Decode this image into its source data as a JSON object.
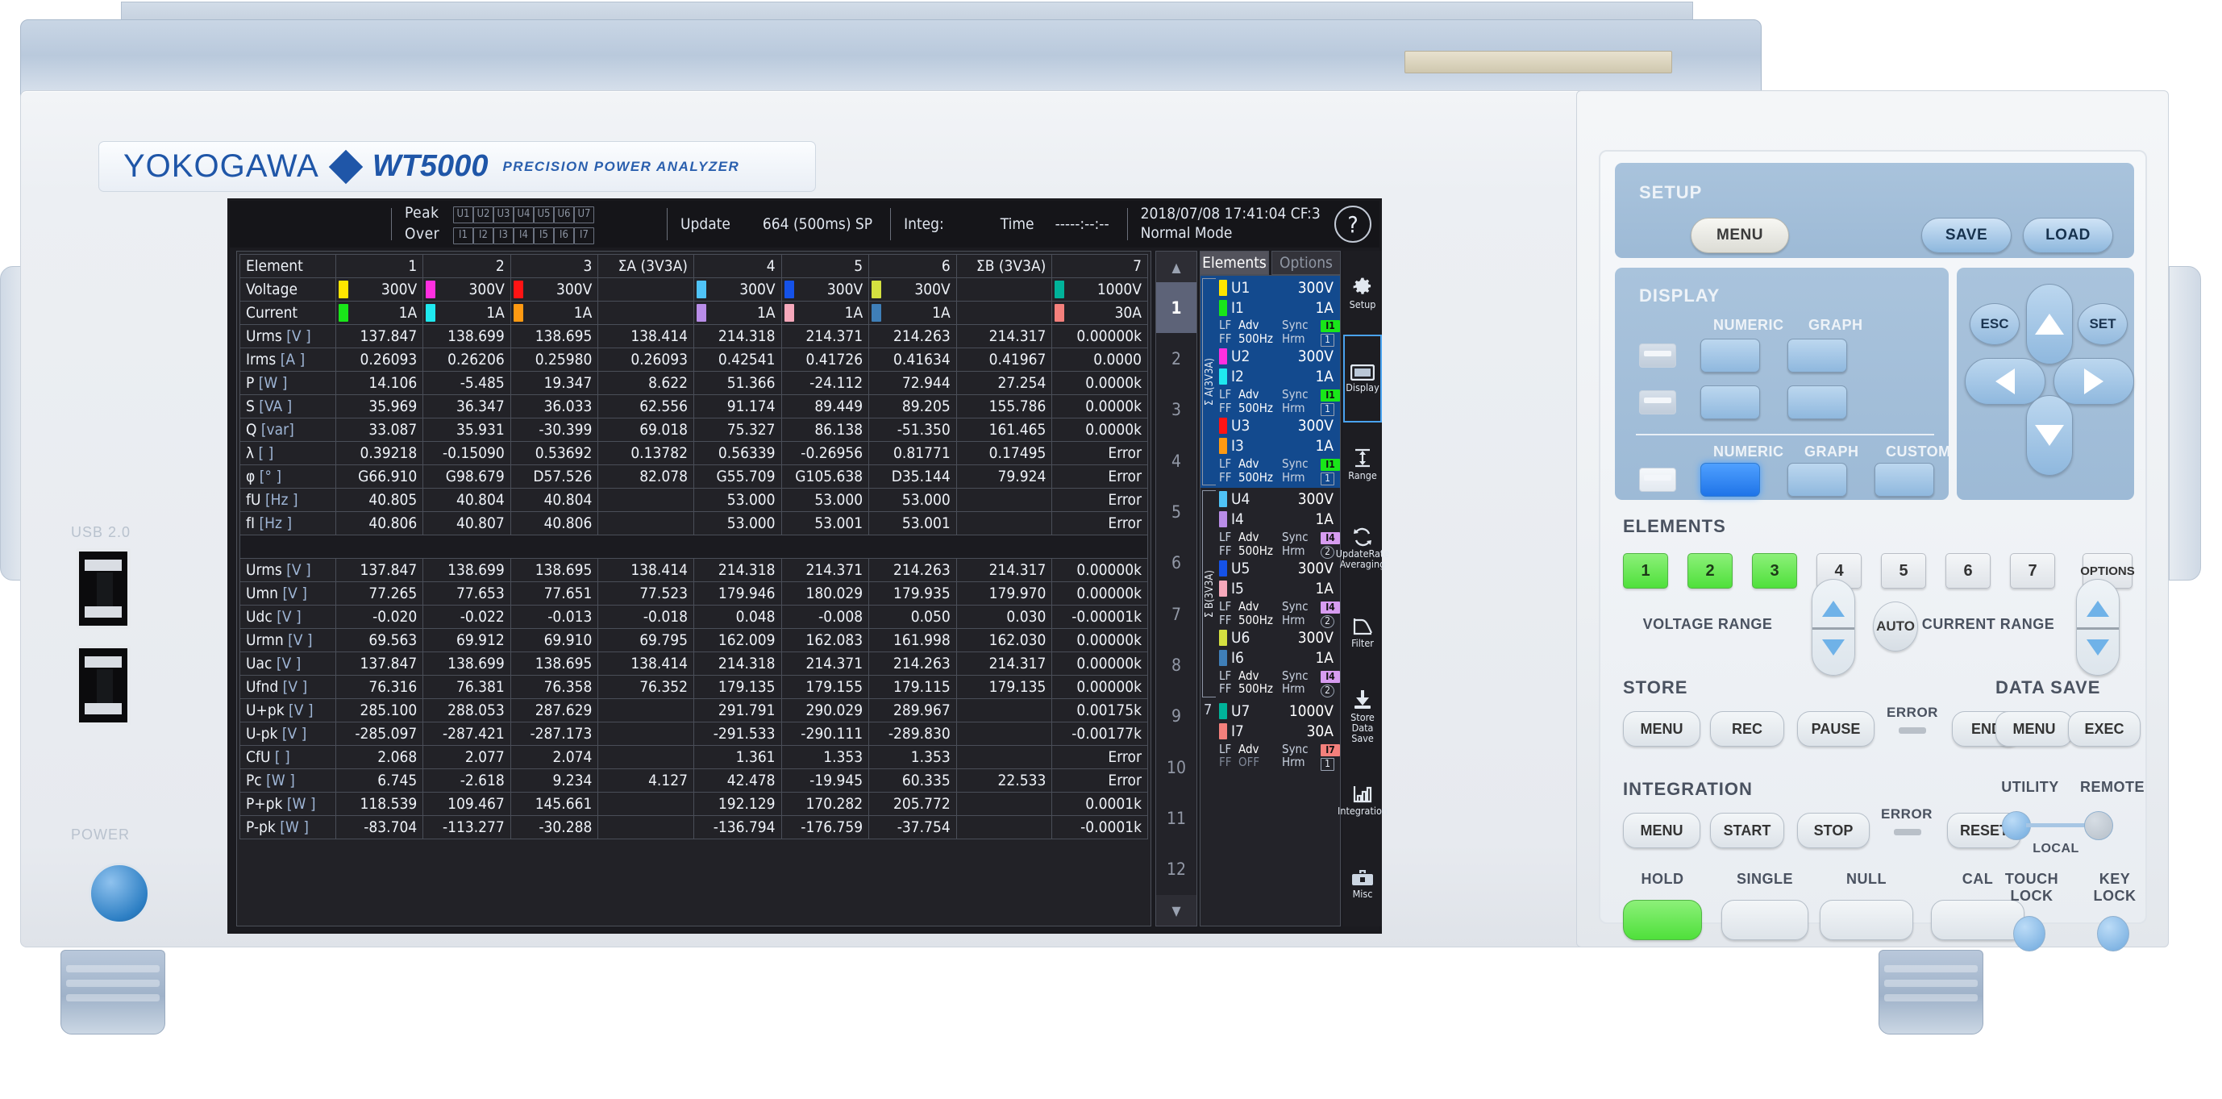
{
  "device": {
    "brand": "YOKOGAWA",
    "model": "WT5000",
    "subtitle": "PRECISION POWER ANALYZER",
    "io": {
      "usb_label": "USB 2.0",
      "power_label": "POWER"
    }
  },
  "screen": {
    "topbar": {
      "peak_label": "Peak",
      "over_label": "Over",
      "peak_chips": [
        "U1",
        "U2",
        "U3",
        "U4",
        "U5",
        "U6",
        "U7"
      ],
      "over_chips": [
        "I1",
        "I2",
        "I3",
        "I4",
        "I5",
        "I6",
        "I7"
      ],
      "update_label": "Update",
      "update_value": "664 (500ms) SP",
      "integ_label": "Integ:",
      "time_label": "Time",
      "time_value": "-----:--:--",
      "datetime": "2018/07/08 17:41:04 CF:3",
      "mode": "Normal Mode",
      "help_icon": "question-mark-icon"
    },
    "table": {
      "header_label": "Element",
      "columns": [
        "1",
        "2",
        "3",
        "ΣA (3V3A)",
        "4",
        "5",
        "6",
        "ΣB (3V3A)",
        "7"
      ],
      "voltage_label": "Voltage",
      "current_label": "Current",
      "voltage_ranges": [
        "300V",
        "300V",
        "300V",
        "",
        "300V",
        "300V",
        "300V",
        "",
        "1000V"
      ],
      "current_ranges": [
        "1A",
        "1A",
        "1A",
        "",
        "1A",
        "1A",
        "1A",
        "",
        "30A"
      ],
      "voltage_colors": [
        "#ffe500",
        "#ff2fe0",
        "#ff1414",
        "",
        "#4fc3f7",
        "#1552e8",
        "#d4e040",
        "",
        "#00b39a"
      ],
      "current_colors": [
        "#19e619",
        "#1fe9ef",
        "#ff9a12",
        "",
        "#b98de8",
        "#f6a8bb",
        "#3f7fb8",
        "",
        "#f4807c"
      ],
      "section1": [
        {
          "name": "Urms",
          "unit": "[V  ]",
          "values": [
            "137.847",
            "138.699",
            "138.695",
            "138.414",
            "214.318",
            "214.371",
            "214.263",
            "214.317",
            "0.00000k"
          ]
        },
        {
          "name": "Irms",
          "unit": "[A  ]",
          "values": [
            "0.26093",
            "0.26206",
            "0.25980",
            "0.26093",
            "0.42541",
            "0.41726",
            "0.41634",
            "0.41967",
            "0.0000"
          ]
        },
        {
          "name": "P",
          "unit": "[W  ]",
          "values": [
            "14.106",
            "-5.485",
            "19.347",
            "8.622",
            "51.366",
            "-24.112",
            "72.944",
            "27.254",
            "0.0000k"
          ]
        },
        {
          "name": "S",
          "unit": "[VA ]",
          "values": [
            "35.969",
            "36.347",
            "36.033",
            "62.556",
            "91.174",
            "89.449",
            "89.205",
            "155.786",
            "0.0000k"
          ]
        },
        {
          "name": "Q",
          "unit": "[var]",
          "values": [
            "33.087",
            "35.931",
            "-30.399",
            "69.018",
            "75.327",
            "86.138",
            "-51.350",
            "161.465",
            "0.0000k"
          ]
        },
        {
          "name": "λ",
          "unit": "[   ]",
          "values": [
            "0.39218",
            "-0.15090",
            "0.53692",
            "0.13782",
            "0.56339",
            "-0.26956",
            "0.81771",
            "0.17495",
            "Error"
          ]
        },
        {
          "name": "φ",
          "unit": "[°  ]",
          "values": [
            "G66.910",
            "G98.679",
            "D57.526",
            "82.078",
            "G55.709",
            "G105.638",
            "D35.144",
            "79.924",
            "Error"
          ]
        },
        {
          "name": "fU",
          "unit": "[Hz ]",
          "values": [
            "40.805",
            "40.804",
            "40.804",
            "",
            "53.000",
            "53.000",
            "53.000",
            "",
            "Error"
          ]
        },
        {
          "name": "fI",
          "unit": "[Hz ]",
          "values": [
            "40.806",
            "40.807",
            "40.806",
            "",
            "53.000",
            "53.001",
            "53.001",
            "",
            "Error"
          ]
        }
      ],
      "section2": [
        {
          "name": "Urms",
          "unit": "[V  ]",
          "values": [
            "137.847",
            "138.699",
            "138.695",
            "138.414",
            "214.318",
            "214.371",
            "214.263",
            "214.317",
            "0.00000k"
          ]
        },
        {
          "name": "Umn",
          "unit": "[V  ]",
          "values": [
            "77.265",
            "77.653",
            "77.651",
            "77.523",
            "179.946",
            "180.029",
            "179.935",
            "179.970",
            "0.00000k"
          ]
        },
        {
          "name": "Udc",
          "unit": "[V  ]",
          "values": [
            "-0.020",
            "-0.022",
            "-0.013",
            "-0.018",
            "0.048",
            "-0.008",
            "0.050",
            "0.030",
            "-0.00001k"
          ]
        },
        {
          "name": "Urmn",
          "unit": "[V  ]",
          "values": [
            "69.563",
            "69.912",
            "69.910",
            "69.795",
            "162.009",
            "162.083",
            "161.998",
            "162.030",
            "0.00000k"
          ]
        },
        {
          "name": "Uac",
          "unit": "[V  ]",
          "values": [
            "137.847",
            "138.699",
            "138.695",
            "138.414",
            "214.318",
            "214.371",
            "214.263",
            "214.317",
            "0.00000k"
          ]
        },
        {
          "name": "Ufnd",
          "unit": "[V  ]",
          "values": [
            "76.316",
            "76.381",
            "76.358",
            "76.352",
            "179.135",
            "179.155",
            "179.115",
            "179.135",
            "0.00000k"
          ]
        },
        {
          "name": "U+pk",
          "unit": "[V  ]",
          "values": [
            "285.100",
            "288.053",
            "287.629",
            "",
            "291.791",
            "290.029",
            "289.967",
            "",
            "0.00175k"
          ]
        },
        {
          "name": "U-pk",
          "unit": "[V  ]",
          "values": [
            "-285.097",
            "-287.421",
            "-287.173",
            "",
            "-291.533",
            "-290.111",
            "-289.830",
            "",
            "-0.00177k"
          ]
        },
        {
          "name": "CfU",
          "unit": "[   ]",
          "values": [
            "2.068",
            "2.077",
            "2.074",
            "",
            "1.361",
            "1.353",
            "1.353",
            "",
            "Error"
          ]
        },
        {
          "name": "Pc",
          "unit": "[W  ]",
          "values": [
            "6.745",
            "-2.618",
            "9.234",
            "4.127",
            "42.478",
            "-19.945",
            "60.335",
            "22.533",
            "Error"
          ]
        },
        {
          "name": "P+pk",
          "unit": "[W  ]",
          "values": [
            "118.539",
            "109.467",
            "145.661",
            "",
            "192.129",
            "170.282",
            "205.772",
            "",
            "0.0001k"
          ]
        },
        {
          "name": "P-pk",
          "unit": "[W  ]",
          "values": [
            "-83.704",
            "-113.277",
            "-30.288",
            "",
            "-136.794",
            "-176.759",
            "-37.754",
            "",
            "-0.0001k"
          ]
        }
      ]
    },
    "scroll": {
      "up_icon": "chevron-up-icon",
      "down_icon": "chevron-down-icon",
      "pages": [
        "1",
        "2",
        "3",
        "4",
        "5",
        "6",
        "7",
        "8",
        "9",
        "10",
        "11",
        "12"
      ],
      "active_page": "1"
    },
    "elements_panel": {
      "tabs": [
        {
          "label": "Elements",
          "active": true
        },
        {
          "label": "Options",
          "active": false
        }
      ],
      "groups": [
        {
          "sigma": "Σ A(3V3A)",
          "highlight": true,
          "number": "",
          "channels": [
            {
              "u_name": "U1",
              "u_range": "300V",
              "u_color": "#ffe500",
              "i_name": "I1",
              "i_range": "1A",
              "i_color": "#19e619",
              "lf": "LF",
              "ff": "FF",
              "adv": "Adv",
              "freq": "500Hz",
              "sync": "Sync",
              "hrm": "Hrm",
              "sync_badge": "I1",
              "sync_badge_color": "#19e619",
              "hrm_badge": "1",
              "hrm_badge_shape": "square"
            },
            {
              "u_name": "U2",
              "u_range": "300V",
              "u_color": "#ff2fe0",
              "i_name": "I2",
              "i_range": "1A",
              "i_color": "#1fe9ef",
              "lf": "LF",
              "ff": "FF",
              "adv": "Adv",
              "freq": "500Hz",
              "sync": "Sync",
              "hrm": "Hrm",
              "sync_badge": "I1",
              "sync_badge_color": "#19e619",
              "hrm_badge": "1",
              "hrm_badge_shape": "square"
            },
            {
              "u_name": "U3",
              "u_range": "300V",
              "u_color": "#ff1414",
              "i_name": "I3",
              "i_range": "1A",
              "i_color": "#ff9a12",
              "lf": "LF",
              "ff": "FF",
              "adv": "Adv",
              "freq": "500Hz",
              "sync": "Sync",
              "hrm": "Hrm",
              "sync_badge": "I1",
              "sync_badge_color": "#19e619",
              "hrm_badge": "1",
              "hrm_badge_shape": "square"
            }
          ]
        },
        {
          "sigma": "Σ B(3V3A)",
          "highlight": false,
          "number": "",
          "channels": [
            {
              "u_name": "U4",
              "u_range": "300V",
              "u_color": "#4fc3f7",
              "i_name": "I4",
              "i_range": "1A",
              "i_color": "#b98de8",
              "lf": "LF",
              "ff": "FF",
              "adv": "Adv",
              "freq": "500Hz",
              "sync": "Sync",
              "hrm": "Hrm",
              "sync_badge": "I4",
              "sync_badge_color": "#d79cf0",
              "hrm_badge": "2",
              "hrm_badge_shape": "circle"
            },
            {
              "u_name": "U5",
              "u_range": "300V",
              "u_color": "#1552e8",
              "i_name": "I5",
              "i_range": "1A",
              "i_color": "#f6a8bb",
              "lf": "LF",
              "ff": "FF",
              "adv": "Adv",
              "freq": "500Hz",
              "sync": "Sync",
              "hrm": "Hrm",
              "sync_badge": "I4",
              "sync_badge_color": "#d79cf0",
              "hrm_badge": "2",
              "hrm_badge_shape": "circle"
            },
            {
              "u_name": "U6",
              "u_range": "300V",
              "u_color": "#d4e040",
              "i_name": "I6",
              "i_range": "1A",
              "i_color": "#3f7fb8",
              "lf": "LF",
              "ff": "FF",
              "adv": "Adv",
              "freq": "500Hz",
              "sync": "Sync",
              "hrm": "Hrm",
              "sync_badge": "I4",
              "sync_badge_color": "#d79cf0",
              "hrm_badge": "2",
              "hrm_badge_shape": "circle"
            }
          ]
        },
        {
          "sigma": "",
          "highlight": false,
          "number": "7",
          "channels": [
            {
              "u_name": "U7",
              "u_range": "1000V",
              "u_color": "#00b39a",
              "i_name": "I7",
              "i_range": "30A",
              "i_color": "#f4807c",
              "lf": "LF",
              "ff": "FF",
              "adv": "Adv",
              "freq": "OFF",
              "freq_dim": true,
              "sync": "Sync",
              "hrm": "Hrm",
              "sync_badge": "I7",
              "sync_badge_color": "#f4807c",
              "hrm_badge": "1",
              "hrm_badge_shape": "square"
            }
          ]
        }
      ]
    },
    "rail": [
      {
        "label": "Setup",
        "icon": "gear-icon",
        "selected": false
      },
      {
        "label": "Display",
        "icon": "monitor-icon",
        "selected": true
      },
      {
        "label": "Range",
        "icon": "range-arrows-icon",
        "selected": false
      },
      {
        "label": "UpdateRate\nAveraging",
        "icon": "refresh-icon",
        "selected": false
      },
      {
        "label": "Filter",
        "icon": "filter-curve-icon",
        "selected": false
      },
      {
        "label": "Store\nData Save",
        "icon": "download-icon",
        "selected": false
      },
      {
        "label": "Integration",
        "icon": "bar-chart-icon",
        "selected": false
      },
      {
        "label": "Misc",
        "icon": "toolbox-icon",
        "selected": false
      }
    ]
  },
  "front_panel": {
    "setup": {
      "title": "SETUP",
      "menu": "MENU",
      "save": "SAVE",
      "load": "LOAD"
    },
    "display": {
      "title": "DISPLAY",
      "row1": [
        "NUMERIC",
        "GRAPH"
      ],
      "row3": [
        "NUMERIC",
        "GRAPH",
        "CUSTOM"
      ],
      "active_button": "NUMERIC"
    },
    "navpad": {
      "esc": "ESC",
      "set": "SET",
      "up_icon": "arrow-up-icon",
      "down_icon": "arrow-down-icon",
      "left_icon": "arrow-left-icon",
      "right_icon": "arrow-right-icon"
    },
    "elements": {
      "title": "ELEMENTS",
      "buttons": [
        {
          "label": "1",
          "on": true
        },
        {
          "label": "2",
          "on": true
        },
        {
          "label": "3",
          "on": true
        },
        {
          "label": "4",
          "on": false
        },
        {
          "label": "5",
          "on": false
        },
        {
          "label": "6",
          "on": false
        },
        {
          "label": "7",
          "on": false
        }
      ],
      "options": "OPTIONS"
    },
    "ranges": {
      "voltage_label": "VOLTAGE RANGE",
      "current_label": "CURRENT RANGE",
      "auto_label": "AUTO"
    },
    "store": {
      "title": "STORE",
      "buttons": [
        "MENU",
        "REC",
        "PAUSE",
        "END"
      ],
      "error_label": "ERROR"
    },
    "data_save": {
      "title": "DATA SAVE",
      "buttons": [
        "MENU",
        "EXEC"
      ]
    },
    "integration": {
      "title": "INTEGRATION",
      "buttons": [
        "MENU",
        "START",
        "STOP",
        "RESET"
      ],
      "error_label": "ERROR"
    },
    "bottom_keys": [
      {
        "label": "HOLD",
        "on": true
      },
      {
        "label": "SINGLE",
        "on": false
      },
      {
        "label": "NULL",
        "on": false
      },
      {
        "label": "CAL",
        "on": false
      }
    ],
    "utility": {
      "utility_label": "UTILITY",
      "remote_label": "REMOTE",
      "local_label": "LOCAL"
    },
    "locks": {
      "touch_lock": "TOUCH\nLOCK",
      "key_lock": "KEY\nLOCK"
    }
  }
}
